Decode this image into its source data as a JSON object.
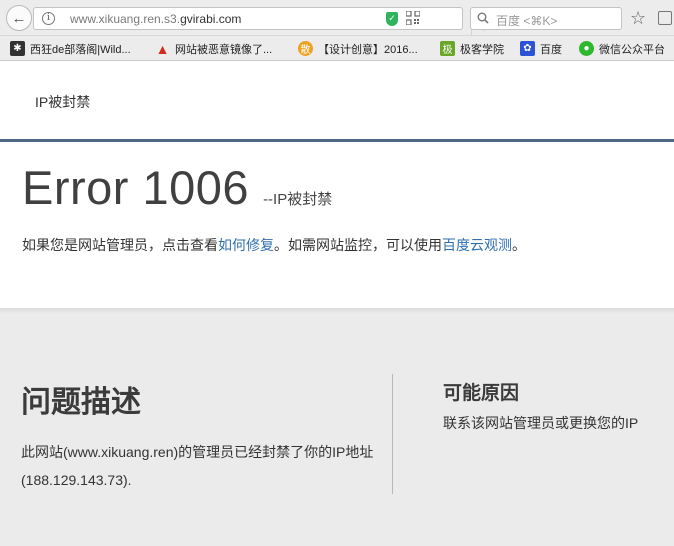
{
  "browser": {
    "url_prefix": "www.xikuang.ren.s3.",
    "url_host": "gvirabi.com",
    "search_placeholder": "百度 <⌘K>",
    "bookmarks": [
      {
        "label": "西狂de部落阁|Wild...",
        "icon": "paw-icon",
        "color": "#333333"
      },
      {
        "label": "网站被恶意镜像了...",
        "icon": "adobe-icon",
        "color": "#d62a1e"
      },
      {
        "label": "【设计创意】2016...",
        "icon": "san-icon",
        "color": "#f0a020",
        "glyph": "散"
      },
      {
        "label": "极客学院",
        "icon": "jike-icon",
        "color": "#6aa628",
        "glyph": "极"
      },
      {
        "label": "百度",
        "icon": "baidu-paw-icon",
        "color": "#2c52d6"
      },
      {
        "label": "微信公众平台",
        "icon": "wechat-icon",
        "color": "#2eb82e"
      }
    ]
  },
  "page": {
    "site_title": "IP被封禁",
    "error_code": "Error 1006",
    "error_subtitle": "--IP被封禁",
    "desc_before": "如果您是网站管理员，点击查看",
    "desc_link1": "如何修复",
    "desc_middle": "。如需网站监控，可以使用",
    "desc_link2": "百度云观测",
    "desc_after": "。",
    "problem_title": "问题描述",
    "problem_text": "此网站(www.xikuang.ren)的管理员已经封禁了你的IP地址(188.129.143.73).",
    "cause_title": "可能原因",
    "cause_text": "联系该网站管理员或更换您的IP"
  }
}
